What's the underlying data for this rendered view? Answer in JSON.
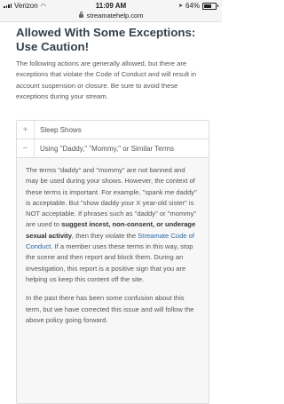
{
  "status_bar": {
    "carrier": "Verizon",
    "time": "11:09 AM",
    "battery": "64%"
  },
  "url_bar": {
    "domain": "streamatehelp.com"
  },
  "page": {
    "title": "Allowed With Some Exceptions: Use Caution!",
    "intro": "The following actions are generally allowed, but there are exceptions that violate the Code of Conduct and will result in account suspension or closure. Be sure to avoid these exceptions during your stream."
  },
  "accordion": {
    "items": [
      {
        "label": "Sleep Shows",
        "icon": "+"
      },
      {
        "label": "Using \"Daddy,\" \"Mommy,\" or Similar Terms",
        "icon": "−"
      }
    ],
    "body": {
      "p1_a": "The terms \"daddy\" and \"mommy\" are not banned and may be used during your shows. However, the context of these terms is important. For example, \"spank me daddy\" is acceptable. But \"show daddy your X year-old sister\" is NOT acceptable. If phrases such as \"daddy\" or \"mommy\" are used to ",
      "p1_bold": "suggest incest, non-consent, or underage sexual activity",
      "p1_b": ", then they violate the ",
      "p1_link": "Streamate Code of Conduct",
      "p1_c": ". If a member uses these terms in this way, stop the scene and then report and block them. During an investigation, this report is a positive sign that you are helping us keep this content off the site.",
      "p2": "In the past there has been some confusion about this term, but we have corrected this issue and will follow the above policy going forward."
    }
  }
}
